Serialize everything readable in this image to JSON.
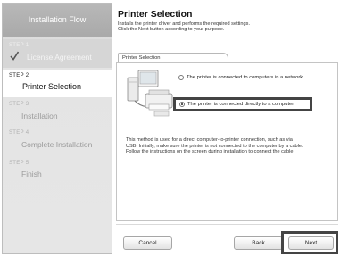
{
  "sidebar": {
    "title": "Installation Flow",
    "steps": [
      {
        "num": "STEP 1",
        "label": "License Agreement",
        "state": "done"
      },
      {
        "num": "STEP 2",
        "label": "Printer Selection",
        "state": "active"
      },
      {
        "num": "STEP 3",
        "label": "Installation",
        "state": "pending"
      },
      {
        "num": "STEP 4",
        "label": "Complete Installation",
        "state": "pending"
      },
      {
        "num": "STEP 5",
        "label": "Finish",
        "state": "pending"
      }
    ]
  },
  "main": {
    "title": "Printer Selection",
    "description_line1": "Installs the printer driver and performs the required settings.",
    "description_line2": "Click the Next button according to your purpose.",
    "tab_label": "Printer Selection",
    "options": [
      {
        "label": "The printer is connected to computers in a network",
        "selected": false
      },
      {
        "label": "The printer is connected directly to a computer",
        "selected": true
      }
    ],
    "note_line1": "This method is used for a direct computer-to-printer connection, such as via",
    "note_line2": "USB. Initially, make sure the printer is not connected to the computer by a cable.",
    "note_line3": "Follow the instructions on the screen during installation to connect the cable."
  },
  "buttons": {
    "cancel": "Cancel",
    "back": "Back",
    "next": "Next"
  },
  "colors": {
    "sidebar_header": "#adadad",
    "sidebar_bg": "#e4e4e4",
    "active_step_bg": "#ffffff",
    "highlight_border": "#444444"
  },
  "icons": {
    "completed_step": "checkmark-icon",
    "illustration": "printer-computer-illustration"
  }
}
